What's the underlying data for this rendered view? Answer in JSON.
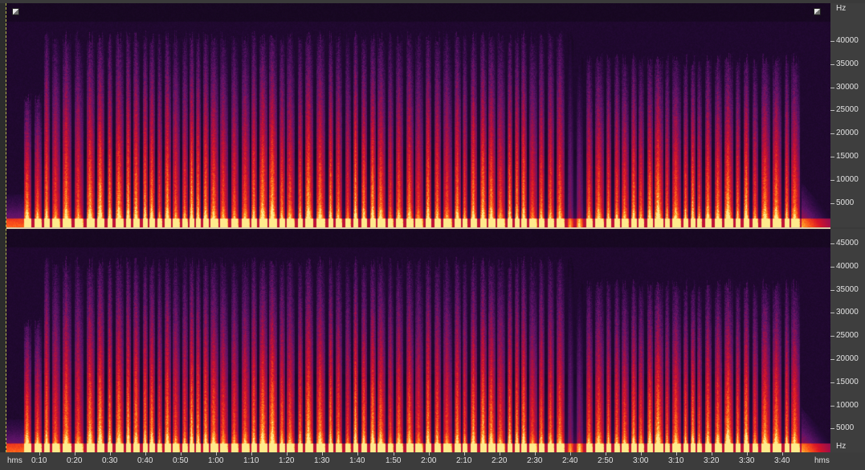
{
  "spectrogram": {
    "frequency_unit": "Hz",
    "time_unit": "hms",
    "channels": [
      {
        "name": "top",
        "frequency_ticks": [
          "40000",
          "35000",
          "30000",
          "25000",
          "20000",
          "15000",
          "10000",
          "5000"
        ],
        "axis_label": "Hz",
        "axis_label_position": "top"
      },
      {
        "name": "bottom",
        "frequency_ticks": [
          "45000",
          "40000",
          "35000",
          "30000",
          "25000",
          "20000",
          "15000",
          "10000",
          "5000"
        ],
        "axis_label": "Hz",
        "axis_label_position": "bottom"
      }
    ],
    "time_axis": {
      "left_label": "hms",
      "right_label": "hms",
      "ticks": [
        "0:10",
        "0:20",
        "0:30",
        "0:40",
        "0:50",
        "1:00",
        "1:10",
        "1:20",
        "1:30",
        "1:40",
        "1:50",
        "2:00",
        "2:10",
        "2:20",
        "2:30",
        "2:40",
        "2:50",
        "3:00",
        "3:10",
        "3:20",
        "3:30",
        "3:40"
      ]
    },
    "colors": {
      "background": "#0c0610",
      "low": "#3a0e52",
      "mid": "#c2102a",
      "high": "#ff7a18",
      "peak": "#ffe070",
      "separator": "#d6c8a8",
      "axis_text": "#e2e2e2"
    }
  }
}
